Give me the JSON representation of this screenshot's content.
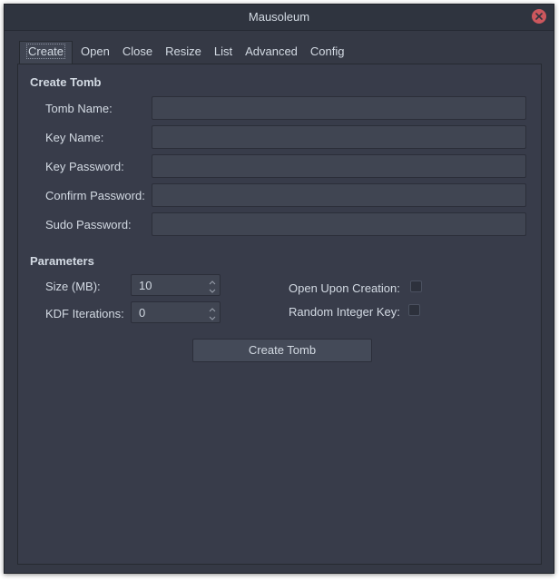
{
  "window": {
    "title": "Mausoleum"
  },
  "tabs": [
    {
      "label": "Create",
      "active": true
    },
    {
      "label": "Open",
      "active": false
    },
    {
      "label": "Close",
      "active": false
    },
    {
      "label": "Resize",
      "active": false
    },
    {
      "label": "List",
      "active": false
    },
    {
      "label": "Advanced",
      "active": false
    },
    {
      "label": "Config",
      "active": false
    }
  ],
  "create_tomb": {
    "title": "Create Tomb",
    "fields": [
      {
        "label": "Tomb Name:",
        "value": ""
      },
      {
        "label": "Key Name:",
        "value": ""
      },
      {
        "label": "Key Password:",
        "value": ""
      },
      {
        "label": "Confirm Password:",
        "value": ""
      },
      {
        "label": "Sudo Password:",
        "value": ""
      }
    ]
  },
  "parameters": {
    "title": "Parameters",
    "size": {
      "label": "Size (MB):",
      "value": "10"
    },
    "kdf": {
      "label": "KDF Iterations:",
      "value": "0"
    },
    "open_upon_creation": {
      "label": "Open Upon Creation:",
      "checked": false
    },
    "random_integer_key": {
      "label": "Random Integer Key:",
      "checked": false
    }
  },
  "actions": {
    "create_button": "Create Tomb"
  },
  "colors": {
    "window_bg": "#353945",
    "accent_close": "#cc575d",
    "text": "#d3dae3"
  },
  "icons": {
    "close": "close-icon",
    "spin_up": "chevron-up-icon",
    "spin_down": "chevron-down-icon"
  }
}
